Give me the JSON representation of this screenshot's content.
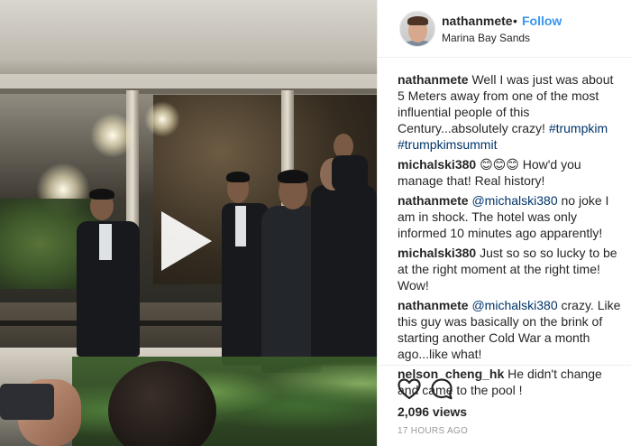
{
  "header": {
    "username": "nathanmete",
    "separator": "•",
    "follow_label": "Follow",
    "location": "Marina Bay Sands"
  },
  "caption": {
    "username": "nathanmete",
    "text": "Well I was just was about 5 Meters away from one of the most influential people of this Century...absolutely crazy!",
    "tags": [
      "#trumpkim",
      "#trumpkimsummit"
    ]
  },
  "comments": [
    {
      "username": "michalski380",
      "mention": "",
      "text": "😊😊😊 How'd you manage that! Real history!"
    },
    {
      "username": "nathanmete",
      "mention": "@michalski380",
      "text": "no joke I am in shock. The hotel was only informed 10 minutes ago apparently!"
    },
    {
      "username": "michalski380",
      "mention": "",
      "text": "Just so so so lucky to be at the right moment at the right time! Wow!"
    },
    {
      "username": "nathanmete",
      "mention": "@michalski380",
      "text": "crazy. Like this guy was basically on the brink of starting another Cold War a month ago...like what!"
    },
    {
      "username": "nelson_cheng_hk",
      "mention": "",
      "text": "He didn't change and came to the pool !"
    }
  ],
  "stats": {
    "views": "2,096 views",
    "timestamp": "17 HOURS AGO"
  },
  "icons": {
    "like": "heart-icon",
    "comment": "comment-bubble-icon",
    "play": "play-icon"
  },
  "colors": {
    "follow": "#3897f0",
    "tag": "#003569",
    "muted": "#999999"
  }
}
